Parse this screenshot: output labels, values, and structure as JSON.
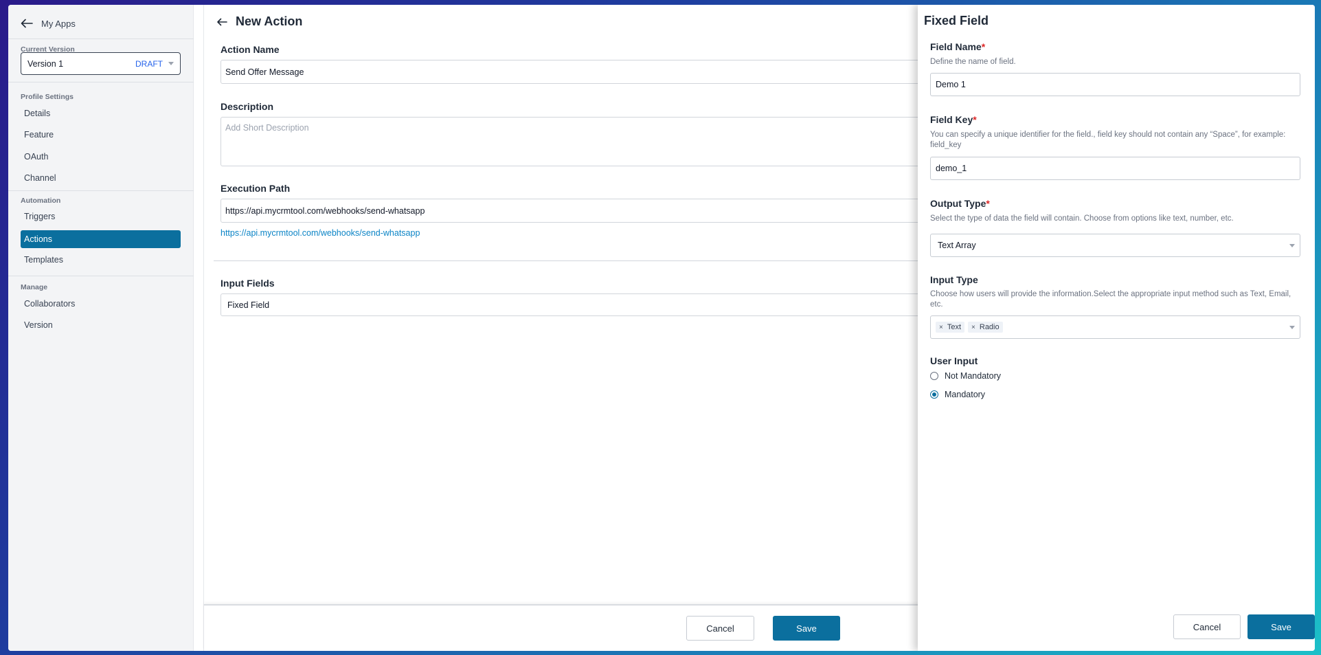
{
  "sidebar": {
    "back_label": "My Apps",
    "current_version_heading": "Current Version",
    "version_name": "Version 1",
    "version_status": "DRAFT",
    "sections": {
      "profile": "Profile Settings",
      "automation": "Automation",
      "manage": "Manage"
    },
    "profile_items": [
      "Details",
      "Feature",
      "OAuth",
      "Channel"
    ],
    "automation_items": [
      "Triggers",
      "Actions",
      "Templates"
    ],
    "manage_items": [
      "Collaborators",
      "Version"
    ],
    "active_item": "Actions"
  },
  "main": {
    "title": "New Action",
    "action_name_label": "Action Name",
    "action_name_value": "Send Offer Message",
    "description_label": "Description",
    "description_placeholder": "Add Short Description",
    "execution_path_label": "Execution Path",
    "execution_path_value": "https://api.mycrmtool.com/webhooks/send-whatsapp",
    "execution_path_link": "https://api.mycrmtool.com/webhooks/send-whatsapp",
    "input_fields_label": "Input Fields",
    "input_field_item": "Fixed Field",
    "cancel_label": "Cancel",
    "save_label": "Save"
  },
  "drawer": {
    "title": "Fixed Field",
    "field_name_label": "Field Name",
    "field_name_help": "Define the name of field.",
    "field_name_value": "Demo 1",
    "field_key_label": "Field Key",
    "field_key_help": "You can specify a unique identifier for the field., field key should not contain any “Space”, for example: field_key",
    "field_key_value": "demo_1",
    "output_type_label": "Output Type",
    "output_type_help": "Select the type of data the field will contain. Choose from options like text, number, etc.",
    "output_type_value": "Text Array",
    "input_type_label": "Input Type",
    "input_type_help": "Choose how users will provide the information.Select the appropriate input method such as Text, Email, etc.",
    "input_type_chips": [
      "Text",
      "Radio"
    ],
    "user_input_label": "User Input",
    "user_input_options": [
      "Not Mandatory",
      "Mandatory"
    ],
    "user_input_selected": "Mandatory",
    "required_mark": "*",
    "cancel_label": "Cancel",
    "save_label": "Save"
  },
  "colors": {
    "primary": "#0b6f9e",
    "link": "#0b84c6",
    "required": "#dc2626",
    "draft": "#2563eb"
  }
}
